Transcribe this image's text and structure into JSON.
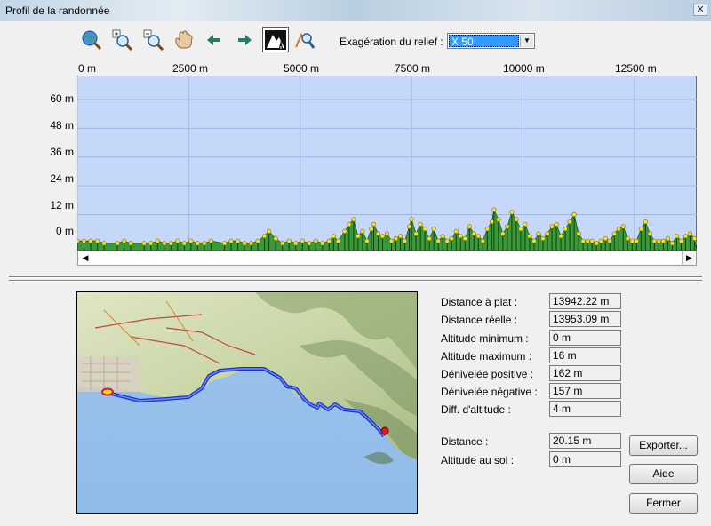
{
  "window": {
    "title": "Profil de la randonnée",
    "close_glyph": "✕"
  },
  "toolbar": {
    "tools": [
      {
        "name": "globe-zoom-icon"
      },
      {
        "name": "zoom-in-icon"
      },
      {
        "name": "zoom-out-icon"
      },
      {
        "name": "pan-hand-icon"
      },
      {
        "name": "arrow-left-icon"
      },
      {
        "name": "arrow-right-icon"
      },
      {
        "name": "relief-mode-icon",
        "pressed": true
      },
      {
        "name": "profile-tool-icon"
      }
    ],
    "relief_label": "Exagération du relief :",
    "relief_value": "X 50",
    "relief_arrow": "▼"
  },
  "profile": {
    "x_ticks": [
      "0 m",
      "2500 m",
      "5000 m",
      "7500 m",
      "10000 m",
      "12500 m"
    ],
    "y_ticks": [
      "60 m",
      "48 m",
      "36 m",
      "24 m",
      "12 m",
      "0 m"
    ],
    "scroll_left": "◀",
    "scroll_right": "▶",
    "colors": {
      "background": "#c6d8fa",
      "grid": "#9fb6e8",
      "fill": "#3a9a3a",
      "point": "#f2e034"
    }
  },
  "chart_data": {
    "type": "area",
    "xlabel": "",
    "ylabel": "",
    "xlim": [
      0,
      13900
    ],
    "ylim": [
      -3,
      70
    ],
    "x_ticks": [
      0,
      2500,
      5000,
      7500,
      10000,
      12500
    ],
    "y_ticks": [
      0,
      12,
      24,
      36,
      48,
      60
    ],
    "grid": true,
    "series": [
      {
        "x": [
          0,
          150,
          300,
          450,
          600,
          900,
          1050,
          1200,
          1500,
          1650,
          1800,
          1950,
          2100,
          2250,
          2400,
          2550,
          2700,
          2850,
          3000,
          3300,
          3450,
          3600,
          3750,
          3900,
          4050,
          4200,
          4300,
          4450,
          4600,
          4750,
          4900,
          5050,
          5200,
          5350,
          5500,
          5650,
          5750,
          5850,
          6000,
          6100,
          6200,
          6300,
          6400,
          6500,
          6600,
          6650,
          6750,
          6850,
          6950,
          7050,
          7150,
          7250,
          7350,
          7450,
          7500,
          7600,
          7700,
          7800,
          7900,
          8000,
          8100,
          8200,
          8300,
          8400,
          8500,
          8600,
          8700,
          8800,
          8900,
          9000,
          9100,
          9200,
          9300,
          9350,
          9450,
          9550,
          9650,
          9750,
          9850,
          9950,
          10050,
          10150,
          10250,
          10350,
          10450,
          10550,
          10650,
          10750,
          10850,
          10950,
          11050,
          11150,
          11250,
          11350,
          11450,
          11550,
          11650,
          11750,
          11850,
          11950,
          12050,
          12150,
          12250,
          12350,
          12450,
          12550,
          12650,
          12750,
          12850,
          12950,
          13050,
          13150,
          13250,
          13350,
          13450,
          13550,
          13650,
          13750,
          13850
        ],
        "y": [
          1,
          1,
          1,
          1,
          0,
          0,
          1,
          0,
          0,
          0,
          1,
          0,
          0,
          1,
          0,
          1,
          0,
          0,
          1,
          0,
          1,
          1,
          0,
          0,
          1,
          3,
          5,
          2,
          0,
          1,
          0,
          1,
          0,
          1,
          0,
          1,
          3,
          1,
          5,
          8,
          10,
          3,
          5,
          1,
          6,
          8,
          4,
          3,
          4,
          1,
          2,
          3,
          1,
          7,
          10,
          4,
          8,
          6,
          2,
          6,
          1,
          3,
          1,
          2,
          5,
          3,
          2,
          7,
          4,
          3,
          1,
          6,
          9,
          14,
          10,
          4,
          7,
          13,
          10,
          6,
          8,
          3,
          1,
          4,
          2,
          4,
          7,
          8,
          3,
          6,
          9,
          12,
          4,
          1,
          1,
          1,
          0,
          1,
          2,
          1,
          4,
          6,
          7,
          2,
          1,
          1,
          6,
          9,
          4,
          1,
          1,
          1,
          2,
          0,
          3,
          1,
          3,
          4,
          2
        ]
      }
    ]
  },
  "map": {
    "name": "route-map"
  },
  "stats": [
    {
      "label": "Distance à plat :",
      "value": "13942.22 m"
    },
    {
      "label": "Distance réelle :",
      "value": "13953.09 m"
    },
    {
      "label": "Altitude minimum :",
      "value": "0 m"
    },
    {
      "label": "Altitude maximum :",
      "value": "16 m"
    },
    {
      "label": "Dénivelée positive :",
      "value": "162 m"
    },
    {
      "label": "Dénivelée négative :",
      "value": "157 m"
    },
    {
      "label": "Diff. d'altitude :",
      "value": "4 m"
    }
  ],
  "cursor": [
    {
      "label": "Distance :",
      "value": "20.15 m"
    },
    {
      "label": "Altitude au sol :",
      "value": "0 m"
    }
  ],
  "buttons": {
    "export": "Exporter...",
    "help": "Aide",
    "close": "Fermer"
  }
}
